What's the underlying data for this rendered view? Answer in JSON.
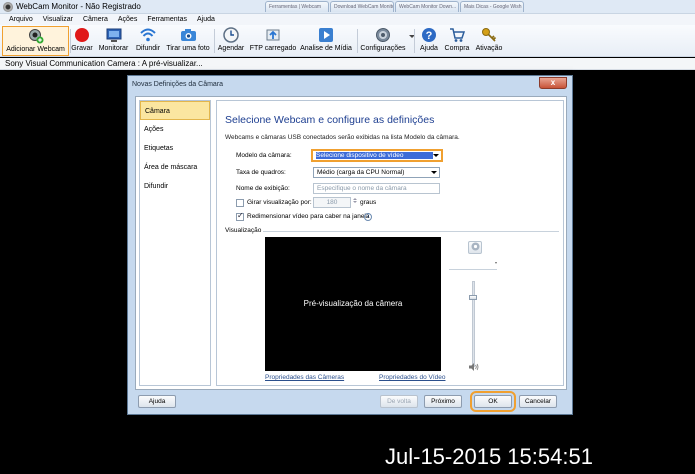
{
  "window": {
    "title": "WebCam Monitor - Não Registrado"
  },
  "browser_tabs": [
    "Ferramentas | Webcam",
    "Download WebCam Monitor",
    "WebCam Monitor Down...",
    "Mais Dicas - Google Wish"
  ],
  "menu": [
    "Arquivo",
    "Visualizar",
    "Câmera",
    "Ações",
    "Ferramentas",
    "Ajuda"
  ],
  "toolbar": {
    "add_webcam": "Adicionar Webcam",
    "record": "Gravar",
    "monitor": "Monitorar",
    "broadcast": "Difundir",
    "photo": "Tirar uma foto",
    "schedule": "Agendar",
    "ftp": "FTP carregado",
    "media_analysis": "Analise de Mídia",
    "settings": "Configurações",
    "help": "Ajuda",
    "buy": "Compra",
    "activate": "Ativação"
  },
  "camera_strip": {
    "text": "Sony Visual Communication Camera : A pré-visualizar..."
  },
  "dialog": {
    "title": "Novas Definições da Câmara",
    "close": "x",
    "nav": [
      "Câmara",
      "Ações",
      "Etiquetas",
      "Área de máscara",
      "Difundir"
    ],
    "heading": "Selecione Webcam e configure as definições",
    "description": "Webcams e câmaras USB conectados serão exibidas na lista Modelo da câmara.",
    "model_label": "Modelo da câmara:",
    "model_value": "Selecione dispositivo de vídeo",
    "framerate_label": "Taxa de quadros:",
    "framerate_value": "Médio (carga da CPU Normal)",
    "display_name_label": "Nome de exibição:",
    "display_name_placeholder": "Especifique o nome da câmara",
    "rotate_label": "Girar visualização por:",
    "rotate_value": "180",
    "rotate_unit": "graus",
    "resize_label": "Redimensionar vídeo para caber na janela",
    "preview_group_label": "Visualização",
    "preview_text": "Pré-visualização da câmera",
    "camera_props_link": "Propriedades das Câmeras",
    "video_props_link": "Propriedades do Vídeo",
    "buttons": {
      "help": "Ajuda",
      "back": "De volta",
      "next": "Próximo",
      "ok": "OK",
      "cancel": "Cancelar"
    }
  },
  "timestamp": "Jul-15-2015 15:54:51",
  "colors": {
    "accent": "#f0a030",
    "heading": "#1e3f91",
    "selection": "#3c6bd8"
  }
}
